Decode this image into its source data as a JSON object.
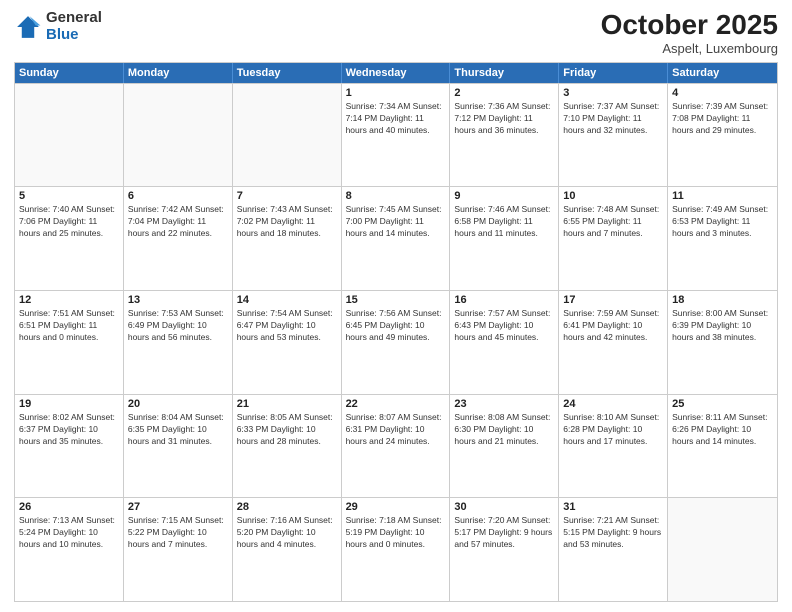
{
  "logo": {
    "general": "General",
    "blue": "Blue"
  },
  "header": {
    "month": "October 2025",
    "location": "Aspelt, Luxembourg"
  },
  "weekdays": [
    "Sunday",
    "Monday",
    "Tuesday",
    "Wednesday",
    "Thursday",
    "Friday",
    "Saturday"
  ],
  "weeks": [
    [
      {
        "day": "",
        "info": ""
      },
      {
        "day": "",
        "info": ""
      },
      {
        "day": "",
        "info": ""
      },
      {
        "day": "1",
        "info": "Sunrise: 7:34 AM\nSunset: 7:14 PM\nDaylight: 11 hours\nand 40 minutes."
      },
      {
        "day": "2",
        "info": "Sunrise: 7:36 AM\nSunset: 7:12 PM\nDaylight: 11 hours\nand 36 minutes."
      },
      {
        "day": "3",
        "info": "Sunrise: 7:37 AM\nSunset: 7:10 PM\nDaylight: 11 hours\nand 32 minutes."
      },
      {
        "day": "4",
        "info": "Sunrise: 7:39 AM\nSunset: 7:08 PM\nDaylight: 11 hours\nand 29 minutes."
      }
    ],
    [
      {
        "day": "5",
        "info": "Sunrise: 7:40 AM\nSunset: 7:06 PM\nDaylight: 11 hours\nand 25 minutes."
      },
      {
        "day": "6",
        "info": "Sunrise: 7:42 AM\nSunset: 7:04 PM\nDaylight: 11 hours\nand 22 minutes."
      },
      {
        "day": "7",
        "info": "Sunrise: 7:43 AM\nSunset: 7:02 PM\nDaylight: 11 hours\nand 18 minutes."
      },
      {
        "day": "8",
        "info": "Sunrise: 7:45 AM\nSunset: 7:00 PM\nDaylight: 11 hours\nand 14 minutes."
      },
      {
        "day": "9",
        "info": "Sunrise: 7:46 AM\nSunset: 6:58 PM\nDaylight: 11 hours\nand 11 minutes."
      },
      {
        "day": "10",
        "info": "Sunrise: 7:48 AM\nSunset: 6:55 PM\nDaylight: 11 hours\nand 7 minutes."
      },
      {
        "day": "11",
        "info": "Sunrise: 7:49 AM\nSunset: 6:53 PM\nDaylight: 11 hours\nand 3 minutes."
      }
    ],
    [
      {
        "day": "12",
        "info": "Sunrise: 7:51 AM\nSunset: 6:51 PM\nDaylight: 11 hours\nand 0 minutes."
      },
      {
        "day": "13",
        "info": "Sunrise: 7:53 AM\nSunset: 6:49 PM\nDaylight: 10 hours\nand 56 minutes."
      },
      {
        "day": "14",
        "info": "Sunrise: 7:54 AM\nSunset: 6:47 PM\nDaylight: 10 hours\nand 53 minutes."
      },
      {
        "day": "15",
        "info": "Sunrise: 7:56 AM\nSunset: 6:45 PM\nDaylight: 10 hours\nand 49 minutes."
      },
      {
        "day": "16",
        "info": "Sunrise: 7:57 AM\nSunset: 6:43 PM\nDaylight: 10 hours\nand 45 minutes."
      },
      {
        "day": "17",
        "info": "Sunrise: 7:59 AM\nSunset: 6:41 PM\nDaylight: 10 hours\nand 42 minutes."
      },
      {
        "day": "18",
        "info": "Sunrise: 8:00 AM\nSunset: 6:39 PM\nDaylight: 10 hours\nand 38 minutes."
      }
    ],
    [
      {
        "day": "19",
        "info": "Sunrise: 8:02 AM\nSunset: 6:37 PM\nDaylight: 10 hours\nand 35 minutes."
      },
      {
        "day": "20",
        "info": "Sunrise: 8:04 AM\nSunset: 6:35 PM\nDaylight: 10 hours\nand 31 minutes."
      },
      {
        "day": "21",
        "info": "Sunrise: 8:05 AM\nSunset: 6:33 PM\nDaylight: 10 hours\nand 28 minutes."
      },
      {
        "day": "22",
        "info": "Sunrise: 8:07 AM\nSunset: 6:31 PM\nDaylight: 10 hours\nand 24 minutes."
      },
      {
        "day": "23",
        "info": "Sunrise: 8:08 AM\nSunset: 6:30 PM\nDaylight: 10 hours\nand 21 minutes."
      },
      {
        "day": "24",
        "info": "Sunrise: 8:10 AM\nSunset: 6:28 PM\nDaylight: 10 hours\nand 17 minutes."
      },
      {
        "day": "25",
        "info": "Sunrise: 8:11 AM\nSunset: 6:26 PM\nDaylight: 10 hours\nand 14 minutes."
      }
    ],
    [
      {
        "day": "26",
        "info": "Sunrise: 7:13 AM\nSunset: 5:24 PM\nDaylight: 10 hours\nand 10 minutes."
      },
      {
        "day": "27",
        "info": "Sunrise: 7:15 AM\nSunset: 5:22 PM\nDaylight: 10 hours\nand 7 minutes."
      },
      {
        "day": "28",
        "info": "Sunrise: 7:16 AM\nSunset: 5:20 PM\nDaylight: 10 hours\nand 4 minutes."
      },
      {
        "day": "29",
        "info": "Sunrise: 7:18 AM\nSunset: 5:19 PM\nDaylight: 10 hours\nand 0 minutes."
      },
      {
        "day": "30",
        "info": "Sunrise: 7:20 AM\nSunset: 5:17 PM\nDaylight: 9 hours\nand 57 minutes."
      },
      {
        "day": "31",
        "info": "Sunrise: 7:21 AM\nSunset: 5:15 PM\nDaylight: 9 hours\nand 53 minutes."
      },
      {
        "day": "",
        "info": ""
      }
    ]
  ]
}
